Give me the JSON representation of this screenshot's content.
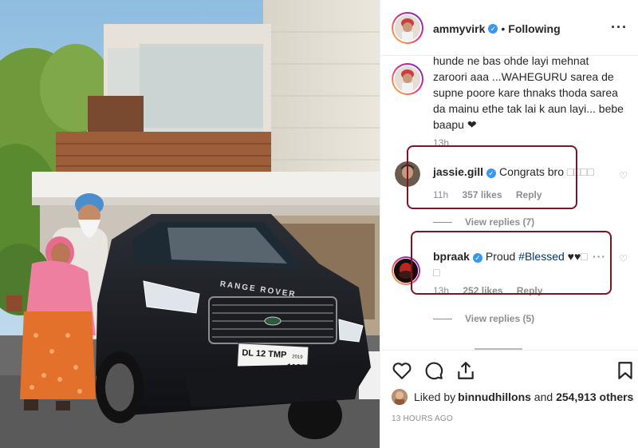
{
  "post": {
    "author": "ammyvirk",
    "follow_dot": "•",
    "follow_status": "Following",
    "more_glyph": "···"
  },
  "caption": {
    "text": "hunde ne bas ohde layi mehnat zaroori aaa ...WAHEGURU sarea de supne poore kare thnaks thoda sarea da mainu ethe tak lai k aun layi... bebe baapu ❤",
    "time": "13h"
  },
  "comments": [
    {
      "username": "jassie.gill",
      "verified": true,
      "text": "Congrats bro ",
      "text_tail": "□□□□",
      "time": "11h",
      "likes": "357 likes",
      "reply": "Reply",
      "view_replies": "View replies (7)"
    },
    {
      "username": "bpraak",
      "verified": true,
      "text_prefix": "Proud ",
      "hashtag": "#Blessed",
      "text_suffix": " ♥♥",
      "text_tail": "□",
      "text_line2": "□",
      "more_glyph": "···",
      "time": "13h",
      "likes": "252 likes",
      "reply": "Reply",
      "view_replies": "View replies (5)"
    }
  ],
  "footer": {
    "liked_by_prefix": "Liked by ",
    "liked_by_user": "binnudhillons",
    "liked_by_and": " and ",
    "liked_by_count": "254,913 others",
    "post_time": "13 HOURS AGO"
  },
  "photo": {
    "plate_line1": "DL 12 TMP",
    "plate_small": "2019",
    "plate_number": "1132",
    "badge_text": "RANGE ROVER"
  },
  "colors": {
    "highlight": "#7a1524",
    "verified": "#3897f0",
    "hashtag": "#003569",
    "meta_gray": "#8e8e8e"
  },
  "icons": {
    "heart": "heart-icon",
    "comment": "comment-icon",
    "share": "share-icon",
    "save": "bookmark-icon",
    "more": "more-options-icon",
    "verified": "verified-badge-icon"
  }
}
